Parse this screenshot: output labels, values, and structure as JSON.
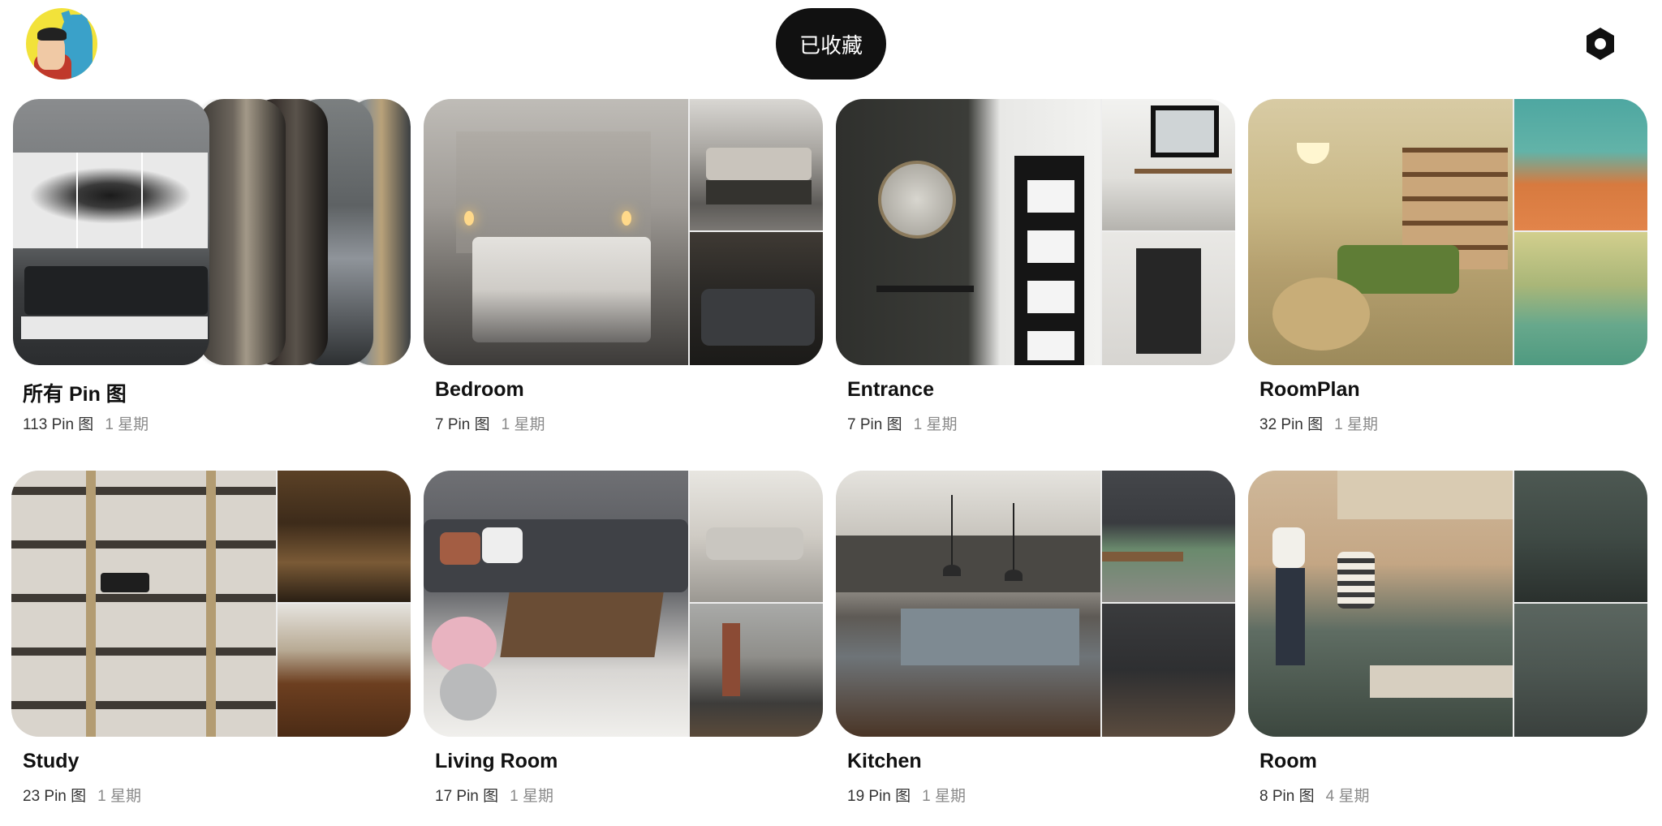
{
  "header": {
    "saved_label": "已收藏"
  },
  "boards": [
    {
      "name": "所有 Pin 图",
      "pins": "113 Pin 图",
      "age": "1 星期"
    },
    {
      "name": "Bedroom",
      "pins": "7 Pin 图",
      "age": "1 星期"
    },
    {
      "name": "Entrance",
      "pins": "7 Pin 图",
      "age": "1 星期"
    },
    {
      "name": "RoomPlan",
      "pins": "32 Pin 图",
      "age": "1 星期"
    },
    {
      "name": "Study",
      "pins": "23 Pin 图",
      "age": "1 星期"
    },
    {
      "name": "Living Room",
      "pins": "17 Pin 图",
      "age": "1 星期"
    },
    {
      "name": "Kitchen",
      "pins": "19 Pin 图",
      "age": "1 星期"
    },
    {
      "name": "Room",
      "pins": "8 Pin 图",
      "age": "4 星期"
    }
  ],
  "icons": {
    "settings": "hexagon-settings-icon"
  }
}
